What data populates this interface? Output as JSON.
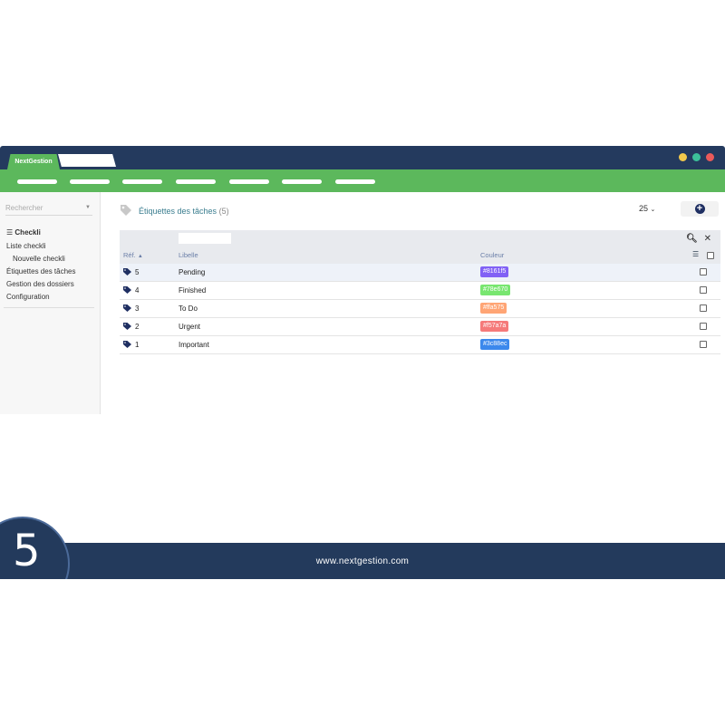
{
  "window": {
    "active_tab": "NextGestion",
    "dots": [
      "#f2c94c",
      "#3cc19a",
      "#eb5a5a"
    ]
  },
  "sidebar": {
    "search_placeholder": "Rechercher",
    "heading": "Checkli",
    "items": [
      {
        "label": "Liste checkli"
      },
      {
        "label": "Nouvelle checkli"
      },
      {
        "label": "Étiquettes des tâches"
      },
      {
        "label": "Gestion des dossiers"
      },
      {
        "label": "Configuration"
      }
    ]
  },
  "main": {
    "title": "Étiquettes des tâches",
    "count": "(5)",
    "per_page": "25"
  },
  "table": {
    "headers": {
      "ref": "Réf.",
      "libelle": "Libelle",
      "couleur": "Couleur"
    },
    "rows": [
      {
        "ref": "5",
        "libelle": "Pending",
        "color_text": "#8161f5",
        "color": "#8161f5"
      },
      {
        "ref": "4",
        "libelle": "Finished",
        "color_text": "#78e670",
        "color": "#78e670"
      },
      {
        "ref": "3",
        "libelle": "To Do",
        "color_text": "#ffa575",
        "color": "#ffa575"
      },
      {
        "ref": "2",
        "libelle": "Urgent",
        "color_text": "#f57a7a",
        "color": "#f57a7a"
      },
      {
        "ref": "1",
        "libelle": "Important",
        "color_text": "#3c88ec",
        "color": "#3c88ec"
      }
    ]
  },
  "footer": {
    "url": "www.nextgestion.com",
    "step": "5"
  }
}
